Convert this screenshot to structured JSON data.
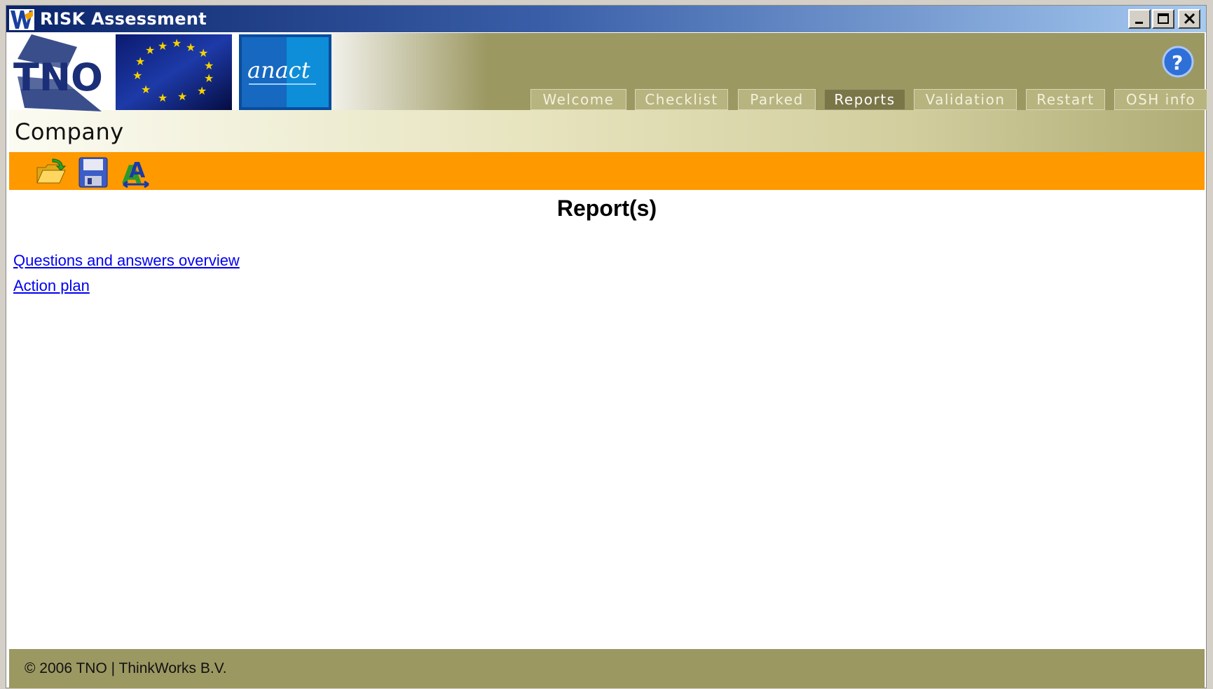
{
  "window": {
    "title": "RISK Assessment",
    "icon": "thinkworks-logo-icon"
  },
  "header": {
    "logos": {
      "tno": "TNO",
      "anact": "anact"
    },
    "company_label": "Company",
    "tabs": [
      {
        "label": "Welcome",
        "active": false
      },
      {
        "label": "Checklist",
        "active": false
      },
      {
        "label": "Parked",
        "active": false
      },
      {
        "label": "Reports",
        "active": true
      },
      {
        "label": "Validation",
        "active": false
      },
      {
        "label": "Restart",
        "active": false
      },
      {
        "label": "OSH info",
        "active": false
      }
    ],
    "help_icon": "help-icon"
  },
  "toolbar": {
    "icons": [
      "open-folder-icon",
      "save-disk-icon",
      "language-icon"
    ],
    "background": "#ff9900"
  },
  "main": {
    "title": "Report(s)",
    "links": [
      "Questions and answers overview",
      "Action plan"
    ]
  },
  "footer": {
    "copyright": "© 2006 TNO | ThinkWorks B.V."
  },
  "colors": {
    "header_olive": "#9c9862",
    "active_tab": "#7a7648",
    "toolbar_orange": "#ff9900",
    "link_blue": "#0000ee"
  }
}
